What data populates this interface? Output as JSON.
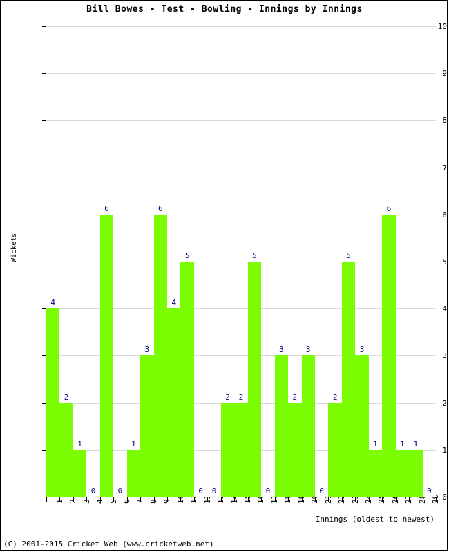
{
  "chart_data": {
    "type": "bar",
    "title": "Bill Bowes - Test - Bowling - Innings by Innings",
    "xlabel": "Innings (oldest to newest)",
    "ylabel": "Wickets",
    "categories": [
      "1",
      "2",
      "3",
      "4",
      "5",
      "6",
      "7",
      "8",
      "9",
      "10",
      "11",
      "12",
      "13",
      "14",
      "15",
      "16",
      "17",
      "18",
      "19",
      "20",
      "21",
      "22",
      "23",
      "24",
      "25",
      "26",
      "27",
      "28",
      "29"
    ],
    "values": [
      4,
      2,
      1,
      0,
      6,
      0,
      1,
      3,
      6,
      4,
      5,
      0,
      0,
      2,
      2,
      5,
      0,
      3,
      2,
      3,
      0,
      2,
      5,
      3,
      1,
      6,
      1,
      1,
      0
    ],
    "ylim": [
      0,
      10
    ],
    "yticks": [
      0,
      1,
      2,
      3,
      4,
      5,
      6,
      7,
      8,
      9,
      10
    ],
    "ytick_labels": [
      "0",
      "1",
      "2",
      "3",
      "4",
      "5",
      "6",
      "7",
      "8",
      "9",
      "10"
    ],
    "grid": true,
    "legend": false,
    "bar_color": "#7CFC00",
    "value_label_color": "#000080",
    "gridline_color": "#D9D9D9",
    "axis_color": "#000000"
  },
  "footer": {
    "copyright": "(C) 2001-2015 Cricket Web (www.cricketweb.net)"
  }
}
